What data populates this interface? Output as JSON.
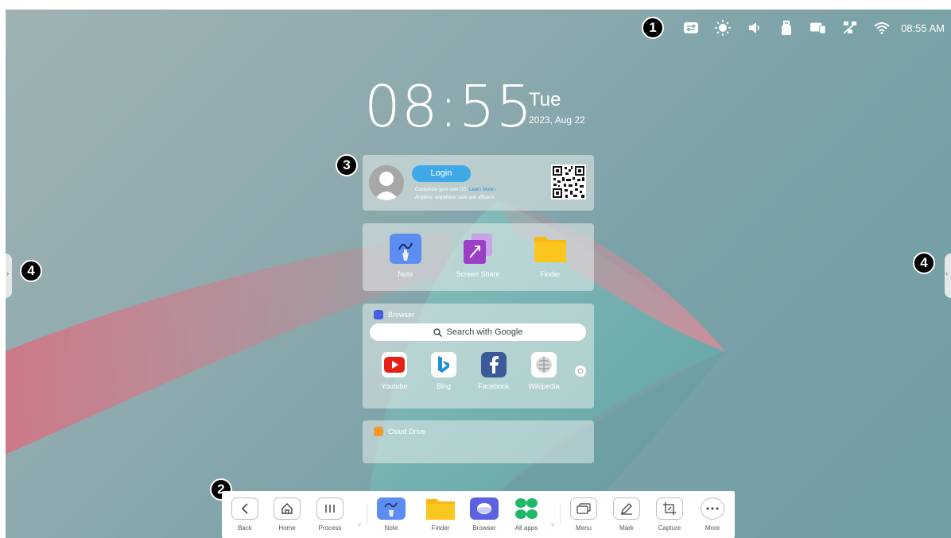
{
  "status_bar": {
    "time": "08:55 AM",
    "icons": [
      "switch-icon",
      "brightness-icon",
      "volume-icon",
      "usb-icon",
      "screen-mirror-icon",
      "network-disconnected-icon",
      "wifi-icon"
    ]
  },
  "markers": {
    "m1": "1",
    "m2": "2",
    "m3": "3",
    "m4_left": "4",
    "m4_right": "4"
  },
  "clock": {
    "time": "08:55",
    "day": "Tue",
    "date": "2023, Aug 22"
  },
  "login": {
    "button": "Login",
    "desc_line1": "Customize your own OS.",
    "desc_link": "Learn More ›",
    "desc_line2": "Anytime, anywhere, safe and efficient."
  },
  "apps": [
    {
      "label": "Note",
      "icon": "note-icon",
      "color": "#5b8ef0"
    },
    {
      "label": "Screen Share",
      "icon": "screen-share-icon",
      "color": "#9b3fc7"
    },
    {
      "label": "Finder",
      "icon": "folder-icon",
      "color": "#f7b90f"
    }
  ],
  "browser": {
    "title": "Browser",
    "search_placeholder": "Search with Google",
    "sites": [
      {
        "label": "Youtube",
        "icon": "youtube-icon",
        "color": "#e62117"
      },
      {
        "label": "Bing",
        "icon": "bing-icon",
        "color": "#1f8fd6"
      },
      {
        "label": "Facebook",
        "icon": "facebook-icon",
        "color": "#3b5a9a"
      },
      {
        "label": "Wikipedia",
        "icon": "wikipedia-icon",
        "color": "#999999"
      }
    ]
  },
  "cloud": {
    "title": "Cloud Drive"
  },
  "dock": {
    "back": "Back",
    "home": "Home",
    "process": "Process",
    "note": "Note",
    "finder": "Finder",
    "browser": "Browser",
    "all_apps": "All apps",
    "menu": "Menu",
    "mark": "Mark",
    "capture": "Capture",
    "more": "More"
  }
}
